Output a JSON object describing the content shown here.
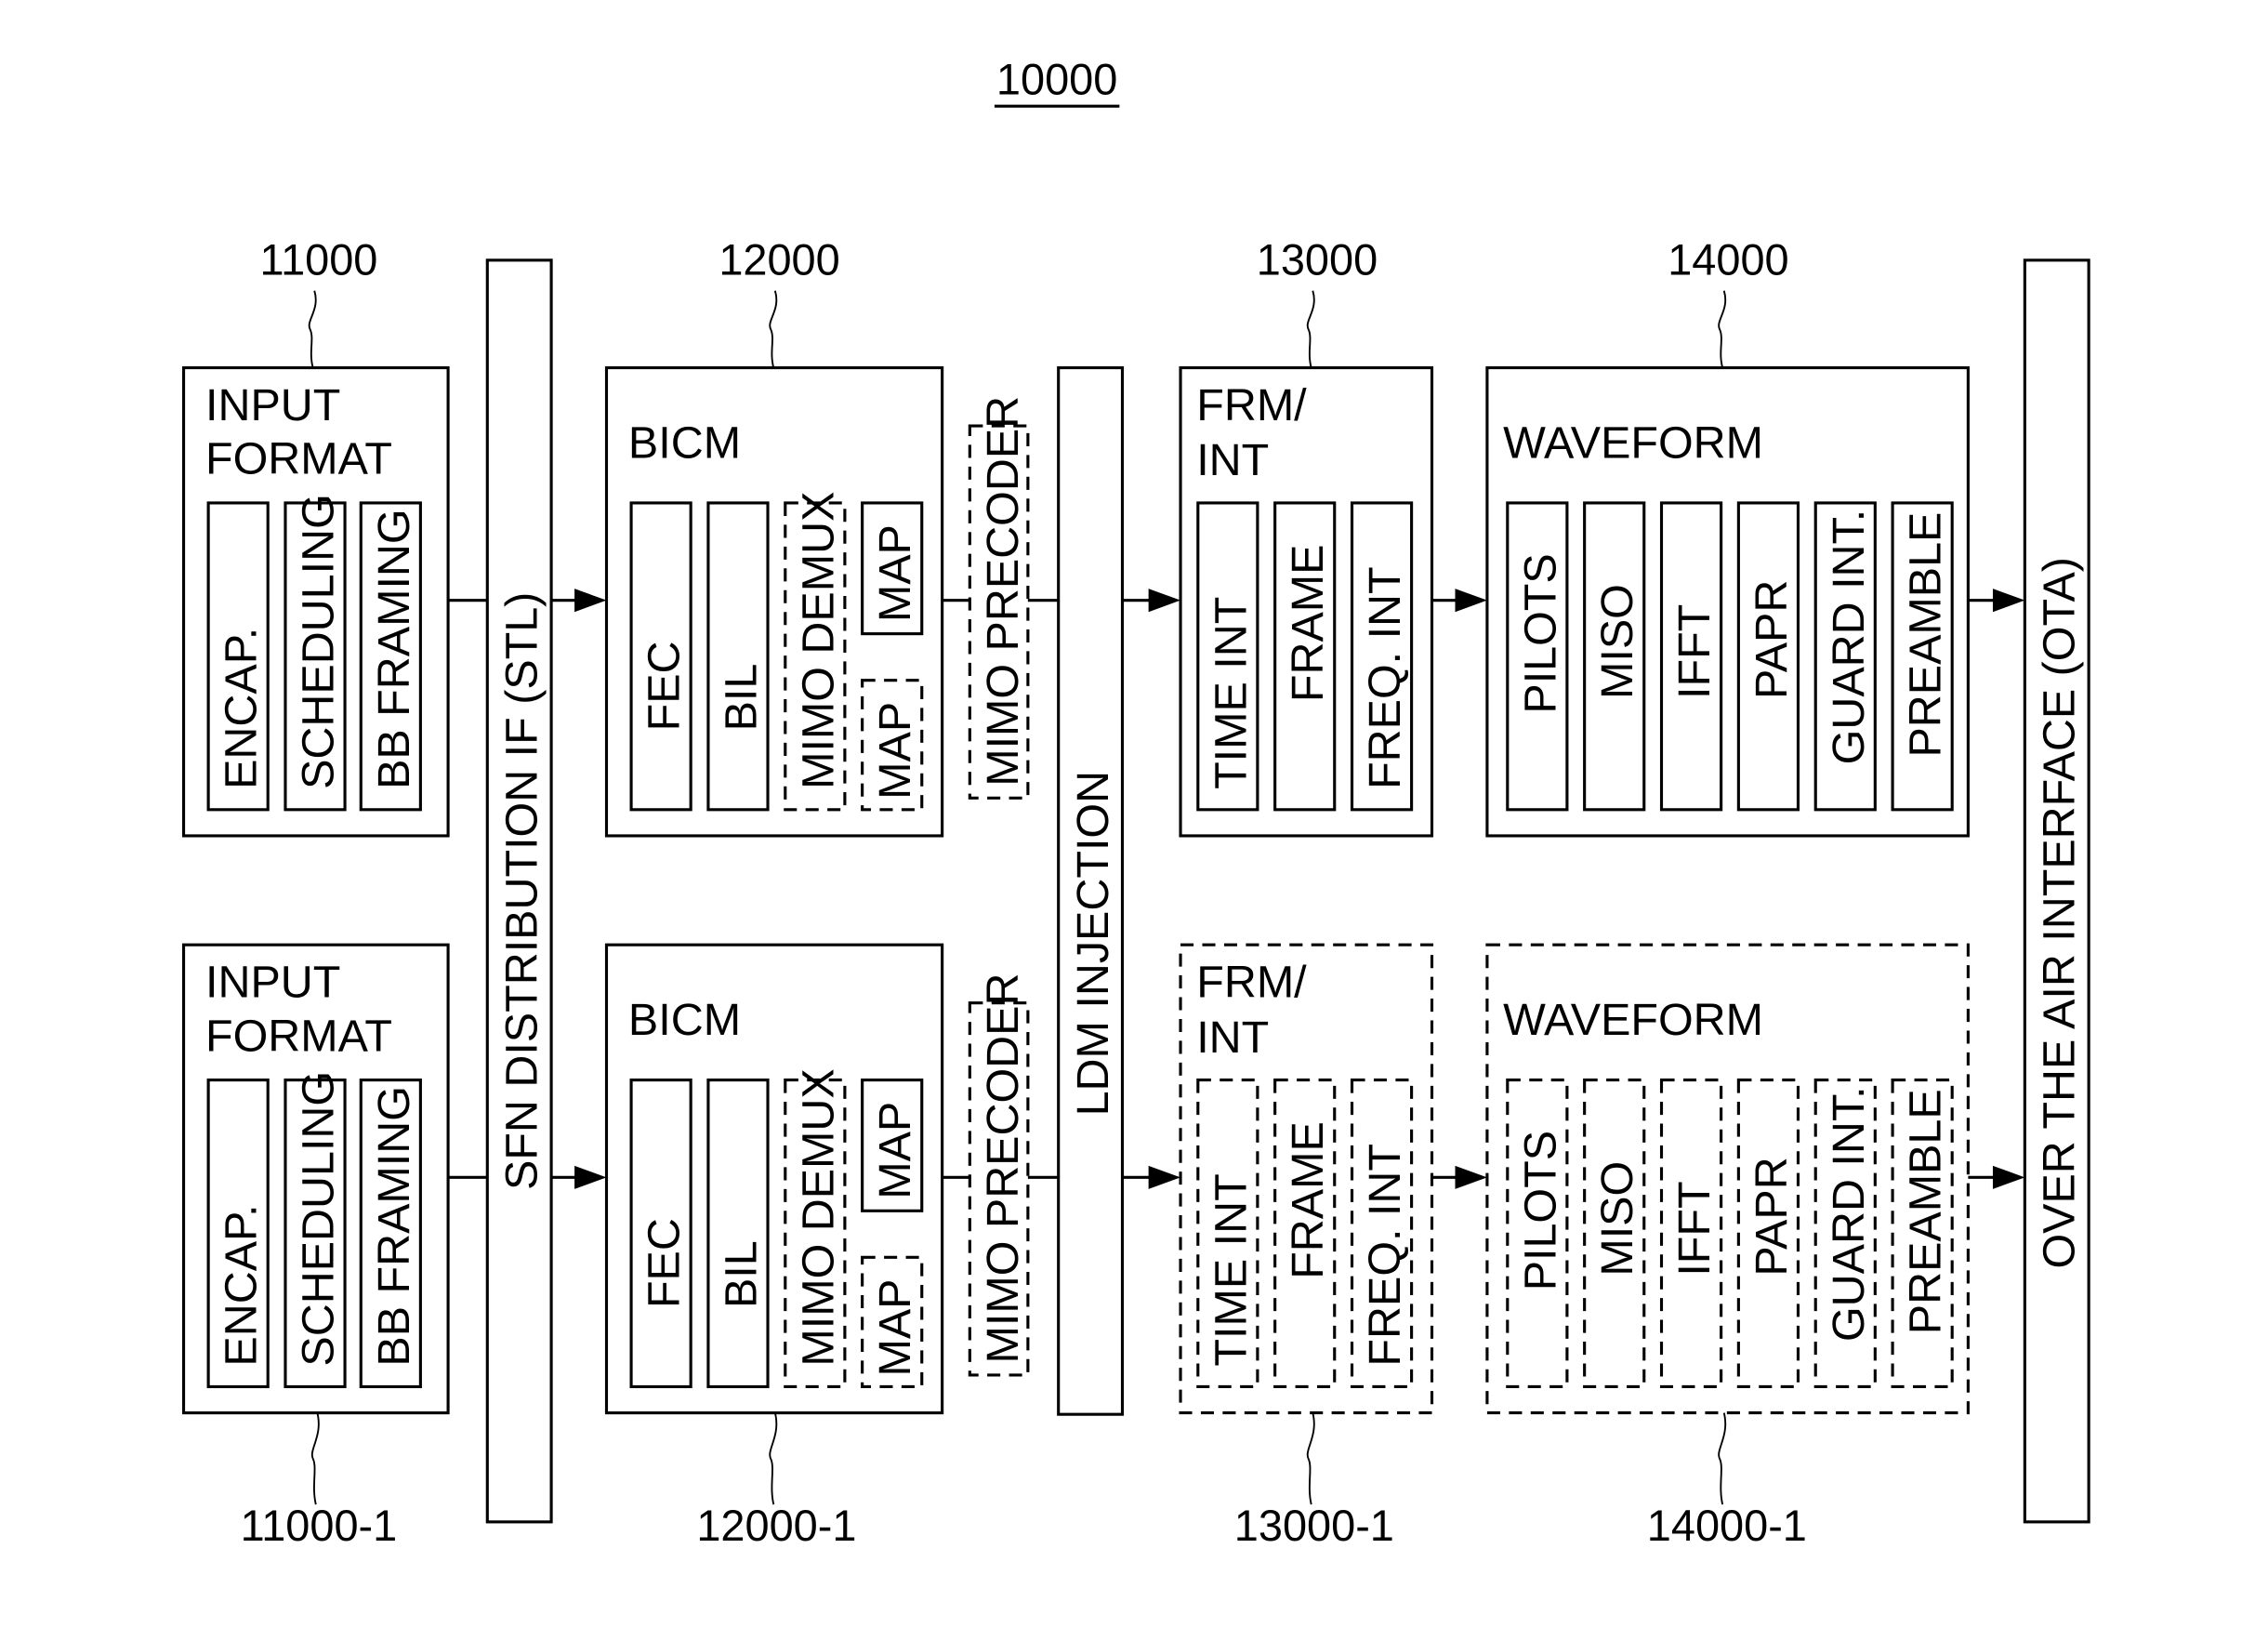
{
  "figure": {
    "ref": "10000",
    "stl": "SFN DISTRIBUTION IF (STL)",
    "ldm": "LDM INJECTION",
    "ota": "OVER THE AIR INTERFACE (OTA)"
  },
  "paths": [
    {
      "input_format": {
        "ref": "11000",
        "title1": "INPUT",
        "title2": "FORMAT",
        "blocks": [
          "ENCAP.",
          "SCHEDULING",
          "BB FRAMING"
        ]
      },
      "bicm": {
        "ref": "12000",
        "title": "BICM",
        "blocks": [
          "FEC",
          "BIL",
          "MIMO DEMUX",
          "MAP",
          "MAP"
        ]
      },
      "mimo_precoder": "MIMO PRECODER",
      "frm_int": {
        "ref": "13000",
        "title1": "FRM/",
        "title2": "INT",
        "blocks": [
          "TIME INT",
          "FRAME",
          "FREQ. INT"
        ]
      },
      "waveform": {
        "ref": "14000",
        "title": "WAVEFORM",
        "blocks": [
          "PILOTS",
          "MISO",
          "IFFT",
          "PAPR",
          "GUARD INT.",
          "PREAMBLE"
        ]
      }
    },
    {
      "input_format": {
        "ref": "11000-1",
        "title1": "INPUT",
        "title2": "FORMAT",
        "blocks": [
          "ENCAP.",
          "SCHEDULING",
          "BB FRAMING"
        ]
      },
      "bicm": {
        "ref": "12000-1",
        "title": "BICM",
        "blocks": [
          "FEC",
          "BIL",
          "MIMO DEMUX",
          "MAP",
          "MAP"
        ]
      },
      "mimo_precoder": "MIMO PRECODER",
      "frm_int": {
        "ref": "13000-1",
        "title1": "FRM/",
        "title2": "INT",
        "blocks": [
          "TIME INT",
          "FRAME",
          "FREQ. INT"
        ]
      },
      "waveform": {
        "ref": "14000-1",
        "title": "WAVEFORM",
        "blocks": [
          "PILOTS",
          "MISO",
          "IFFT",
          "PAPR",
          "GUARD INT.",
          "PREAMBLE"
        ]
      }
    }
  ]
}
